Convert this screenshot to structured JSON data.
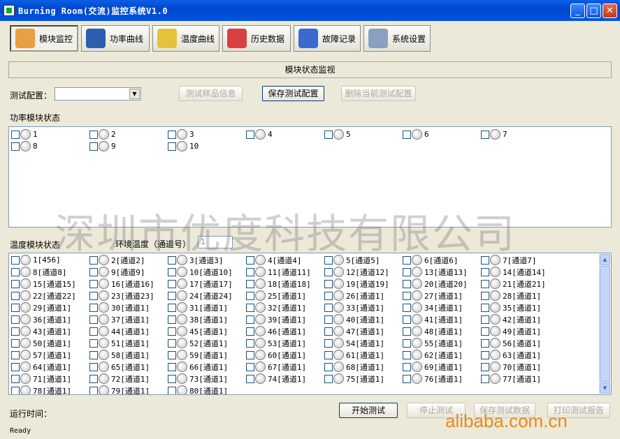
{
  "window": {
    "title": "Burning Room(交流)监控系统V1.0",
    "minimize": "_",
    "maximize": "□",
    "close": "✕"
  },
  "toolbar": [
    {
      "label": "模块监控",
      "icon": "module-monitor-icon",
      "color": "#e8a040",
      "active": true
    },
    {
      "label": "功率曲线",
      "icon": "power-curve-icon",
      "color": "#2b5fb0"
    },
    {
      "label": "温度曲线",
      "icon": "temperature-curve-icon",
      "color": "#e6c23a"
    },
    {
      "label": "历史数据",
      "icon": "history-data-icon",
      "color": "#d94040"
    },
    {
      "label": "故障记录",
      "icon": "fault-record-icon",
      "color": "#3a6ad0"
    },
    {
      "label": "系统设置",
      "icon": "system-settings-icon",
      "color": "#8aa0c0"
    }
  ],
  "section_title": "模块状态监视",
  "config": {
    "label": "测试配置：",
    "combo_value": "",
    "btn_sample_info": "测试样品信息",
    "btn_save_config": "保存测试配置",
    "btn_delete_config": "删除当前测试配置"
  },
  "power": {
    "label": "功率模块状态",
    "channels": [
      "1",
      "2",
      "3",
      "4",
      "5",
      "6",
      "7",
      "8",
      "9",
      "10"
    ]
  },
  "temperature": {
    "label": "温度模块状态",
    "ambient_label": "环境温度（通道号）",
    "ambient_value": "1",
    "channels": [
      "1[456]",
      "2[通道2]",
      "3[通道3]",
      "4[通道4]",
      "5[通道5]",
      "6[通道6]",
      "7[通道7]",
      "8[通道8]",
      "9[通道9]",
      "10[通道10]",
      "11[通道11]",
      "12[通道12]",
      "13[通道13]",
      "14[通道14]",
      "15[通道15]",
      "16[通道16]",
      "17[通道17]",
      "18[通道18]",
      "19[通道19]",
      "20[通道20]",
      "21[通道21]",
      "22[通道22]",
      "23[通道23]",
      "24[通道24]",
      "25[通道1]",
      "26[通道1]",
      "27[通道1]",
      "28[通道1]",
      "29[通道1]",
      "30[通道1]",
      "31[通道1]",
      "32[通道1]",
      "33[通道1]",
      "34[通道1]",
      "35[通道1]",
      "36[通道1]",
      "37[通道1]",
      "38[通道1]",
      "39[通道1]",
      "40[通道1]",
      "41[通道1]",
      "42[通道1]",
      "43[通道1]",
      "44[通道1]",
      "45[通道1]",
      "46[通道1]",
      "47[通道1]",
      "48[通道1]",
      "49[通道1]",
      "50[通道1]",
      "51[通道1]",
      "52[通道1]",
      "53[通道1]",
      "54[通道1]",
      "55[通道1]",
      "56[通道1]",
      "57[通道1]",
      "58[通道1]",
      "59[通道1]",
      "60[通道1]",
      "61[通道1]",
      "62[通道1]",
      "63[通道1]",
      "64[通道1]",
      "65[通道1]",
      "66[通道1]",
      "67[通道1]",
      "68[通道1]",
      "69[通道1]",
      "70[通道1]",
      "71[通道1]",
      "72[通道1]",
      "73[通道1]",
      "74[通道1]",
      "75[通道1]",
      "76[通道1]",
      "77[通道1]",
      "78[通道1]",
      "79[通道1]",
      "80[通道1]"
    ]
  },
  "bottom": {
    "runtime_label": "运行时间：",
    "btn_start": "开始测试",
    "btn_stop": "停止测试",
    "btn_save_data": "保存测试数据",
    "btn_print": "打印测试报告"
  },
  "watermark": "深圳市优度科技有限公司",
  "site_watermark": "alibaba.com.cn",
  "status": "Ready"
}
